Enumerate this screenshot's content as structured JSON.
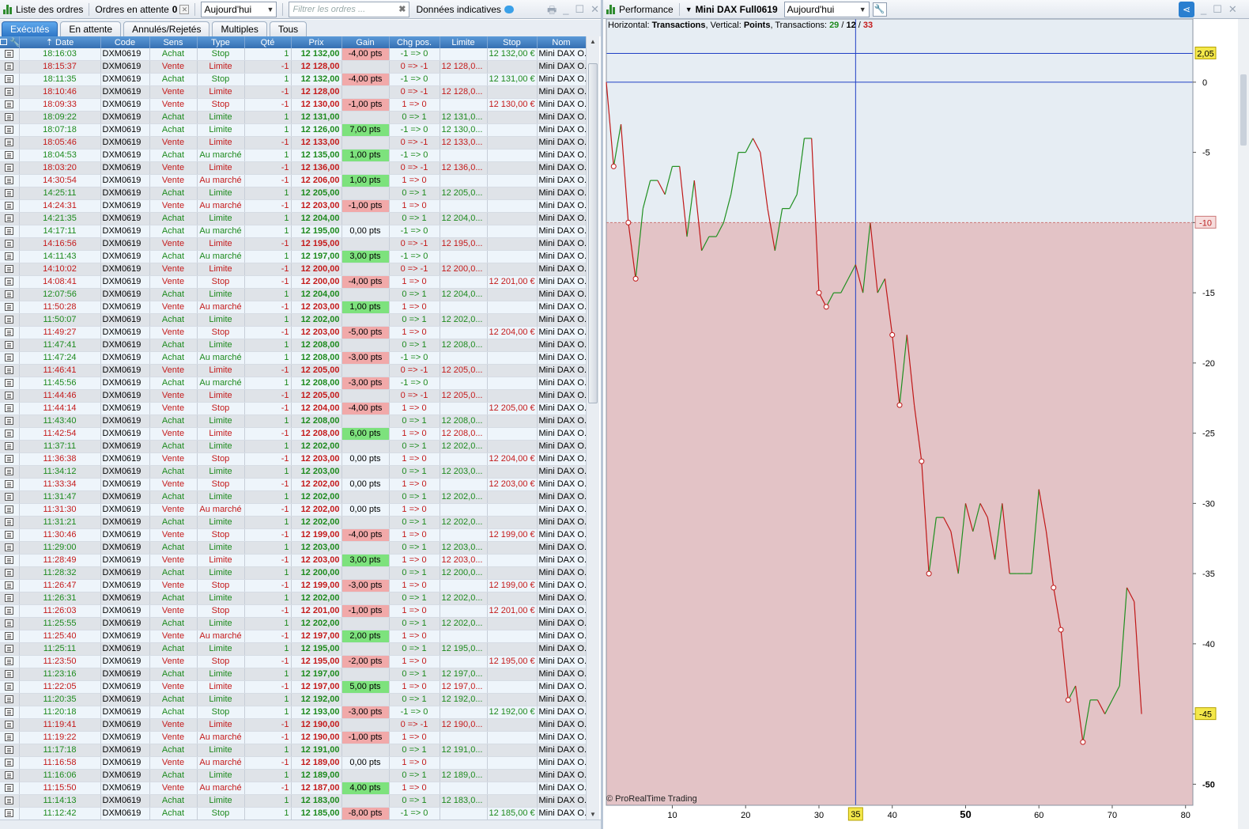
{
  "left_panel": {
    "title": "Liste des ordres",
    "pending_label": "Ordres en attente",
    "pending_count": "0",
    "period_select": "Aujourd'hui",
    "filter_placeholder": "Filtrer les ordres ...",
    "indicative_label": "Données indicatives",
    "tabs": [
      {
        "label": "Exécutés",
        "active": true
      },
      {
        "label": "En attente",
        "active": false
      },
      {
        "label": "Annulés/Rejetés",
        "active": false
      },
      {
        "label": "Multiples",
        "active": false
      },
      {
        "label": "Tous",
        "active": false
      }
    ],
    "columns": [
      "Date",
      "Code",
      "Sens",
      "Type",
      "Qté",
      "Prix",
      "Gain",
      "Chg pos.",
      "Limite",
      "Stop",
      "Nom"
    ],
    "rows": [
      [
        "18:16:03",
        "DXM0619",
        "Achat",
        "Stop",
        "1",
        "12 132,00",
        "-4,00 pts",
        "-1 => 0",
        "",
        "12 132,00 €",
        "Mini DAX O..."
      ],
      [
        "18:15:37",
        "DXM0619",
        "Vente",
        "Limite",
        "-1",
        "12 128,00",
        "",
        "0 => -1",
        "12 128,0...",
        "",
        "Mini DAX O..."
      ],
      [
        "18:11:35",
        "DXM0619",
        "Achat",
        "Stop",
        "1",
        "12 132,00",
        "-4,00 pts",
        "-1 => 0",
        "",
        "12 131,00 €",
        "Mini DAX O..."
      ],
      [
        "18:10:46",
        "DXM0619",
        "Vente",
        "Limite",
        "-1",
        "12 128,00",
        "",
        "0 => -1",
        "12 128,0...",
        "",
        "Mini DAX O..."
      ],
      [
        "18:09:33",
        "DXM0619",
        "Vente",
        "Stop",
        "-1",
        "12 130,00",
        "-1,00 pts",
        "1 => 0",
        "",
        "12 130,00 €",
        "Mini DAX O..."
      ],
      [
        "18:09:22",
        "DXM0619",
        "Achat",
        "Limite",
        "1",
        "12 131,00",
        "",
        "0 => 1",
        "12 131,0...",
        "",
        "Mini DAX O..."
      ],
      [
        "18:07:18",
        "DXM0619",
        "Achat",
        "Limite",
        "1",
        "12 126,00",
        "7,00 pts",
        "-1 => 0",
        "12 130,0...",
        "",
        "Mini DAX O..."
      ],
      [
        "18:05:46",
        "DXM0619",
        "Vente",
        "Limite",
        "-1",
        "12 133,00",
        "",
        "0 => -1",
        "12 133,0...",
        "",
        "Mini DAX O..."
      ],
      [
        "18:04:53",
        "DXM0619",
        "Achat",
        "Au marché",
        "1",
        "12 135,00",
        "1,00 pts",
        "-1 => 0",
        "",
        "",
        "Mini DAX O..."
      ],
      [
        "18:03:20",
        "DXM0619",
        "Vente",
        "Limite",
        "-1",
        "12 136,00",
        "",
        "0 => -1",
        "12 136,0...",
        "",
        "Mini DAX O..."
      ],
      [
        "14:30:54",
        "DXM0619",
        "Vente",
        "Au marché",
        "-1",
        "12 206,00",
        "1,00 pts",
        "1 => 0",
        "",
        "",
        "Mini DAX O..."
      ],
      [
        "14:25:11",
        "DXM0619",
        "Achat",
        "Limite",
        "1",
        "12 205,00",
        "",
        "0 => 1",
        "12 205,0...",
        "",
        "Mini DAX O..."
      ],
      [
        "14:24:31",
        "DXM0619",
        "Vente",
        "Au marché",
        "-1",
        "12 203,00",
        "-1,00 pts",
        "1 => 0",
        "",
        "",
        "Mini DAX O..."
      ],
      [
        "14:21:35",
        "DXM0619",
        "Achat",
        "Limite",
        "1",
        "12 204,00",
        "",
        "0 => 1",
        "12 204,0...",
        "",
        "Mini DAX O..."
      ],
      [
        "14:17:11",
        "DXM0619",
        "Achat",
        "Au marché",
        "1",
        "12 195,00",
        "0,00 pts",
        "-1 => 0",
        "",
        "",
        "Mini DAX O..."
      ],
      [
        "14:16:56",
        "DXM0619",
        "Vente",
        "Limite",
        "-1",
        "12 195,00",
        "",
        "0 => -1",
        "12 195,0...",
        "",
        "Mini DAX O..."
      ],
      [
        "14:11:43",
        "DXM0619",
        "Achat",
        "Au marché",
        "1",
        "12 197,00",
        "3,00 pts",
        "-1 => 0",
        "",
        "",
        "Mini DAX O..."
      ],
      [
        "14:10:02",
        "DXM0619",
        "Vente",
        "Limite",
        "-1",
        "12 200,00",
        "",
        "0 => -1",
        "12 200,0...",
        "",
        "Mini DAX O..."
      ],
      [
        "14:08:41",
        "DXM0619",
        "Vente",
        "Stop",
        "-1",
        "12 200,00",
        "-4,00 pts",
        "1 => 0",
        "",
        "12 201,00 €",
        "Mini DAX O..."
      ],
      [
        "12:07:56",
        "DXM0619",
        "Achat",
        "Limite",
        "1",
        "12 204,00",
        "",
        "0 => 1",
        "12 204,0...",
        "",
        "Mini DAX O..."
      ],
      [
        "11:50:28",
        "DXM0619",
        "Vente",
        "Au marché",
        "-1",
        "12 203,00",
        "1,00 pts",
        "1 => 0",
        "",
        "",
        "Mini DAX O..."
      ],
      [
        "11:50:07",
        "DXM0619",
        "Achat",
        "Limite",
        "1",
        "12 202,00",
        "",
        "0 => 1",
        "12 202,0...",
        "",
        "Mini DAX O..."
      ],
      [
        "11:49:27",
        "DXM0619",
        "Vente",
        "Stop",
        "-1",
        "12 203,00",
        "-5,00 pts",
        "1 => 0",
        "",
        "12 204,00 €",
        "Mini DAX O..."
      ],
      [
        "11:47:41",
        "DXM0619",
        "Achat",
        "Limite",
        "1",
        "12 208,00",
        "",
        "0 => 1",
        "12 208,0...",
        "",
        "Mini DAX O..."
      ],
      [
        "11:47:24",
        "DXM0619",
        "Achat",
        "Au marché",
        "1",
        "12 208,00",
        "-3,00 pts",
        "-1 => 0",
        "",
        "",
        "Mini DAX O..."
      ],
      [
        "11:46:41",
        "DXM0619",
        "Vente",
        "Limite",
        "-1",
        "12 205,00",
        "",
        "0 => -1",
        "12 205,0...",
        "",
        "Mini DAX O..."
      ],
      [
        "11:45:56",
        "DXM0619",
        "Achat",
        "Au marché",
        "1",
        "12 208,00",
        "-3,00 pts",
        "-1 => 0",
        "",
        "",
        "Mini DAX O..."
      ],
      [
        "11:44:46",
        "DXM0619",
        "Vente",
        "Limite",
        "-1",
        "12 205,00",
        "",
        "0 => -1",
        "12 205,0...",
        "",
        "Mini DAX O..."
      ],
      [
        "11:44:14",
        "DXM0619",
        "Vente",
        "Stop",
        "-1",
        "12 204,00",
        "-4,00 pts",
        "1 => 0",
        "",
        "12 205,00 €",
        "Mini DAX O..."
      ],
      [
        "11:43:40",
        "DXM0619",
        "Achat",
        "Limite",
        "1",
        "12 208,00",
        "",
        "0 => 1",
        "12 208,0...",
        "",
        "Mini DAX O..."
      ],
      [
        "11:42:54",
        "DXM0619",
        "Vente",
        "Limite",
        "-1",
        "12 208,00",
        "6,00 pts",
        "1 => 0",
        "12 208,0...",
        "",
        "Mini DAX O..."
      ],
      [
        "11:37:11",
        "DXM0619",
        "Achat",
        "Limite",
        "1",
        "12 202,00",
        "",
        "0 => 1",
        "12 202,0...",
        "",
        "Mini DAX O..."
      ],
      [
        "11:36:38",
        "DXM0619",
        "Vente",
        "Stop",
        "-1",
        "12 203,00",
        "0,00 pts",
        "1 => 0",
        "",
        "12 204,00 €",
        "Mini DAX O..."
      ],
      [
        "11:34:12",
        "DXM0619",
        "Achat",
        "Limite",
        "1",
        "12 203,00",
        "",
        "0 => 1",
        "12 203,0...",
        "",
        "Mini DAX O..."
      ],
      [
        "11:33:34",
        "DXM0619",
        "Vente",
        "Stop",
        "-1",
        "12 202,00",
        "0,00 pts",
        "1 => 0",
        "",
        "12 203,00 €",
        "Mini DAX O..."
      ],
      [
        "11:31:47",
        "DXM0619",
        "Achat",
        "Limite",
        "1",
        "12 202,00",
        "",
        "0 => 1",
        "12 202,0...",
        "",
        "Mini DAX O..."
      ],
      [
        "11:31:30",
        "DXM0619",
        "Vente",
        "Au marché",
        "-1",
        "12 202,00",
        "0,00 pts",
        "1 => 0",
        "",
        "",
        "Mini DAX O..."
      ],
      [
        "11:31:21",
        "DXM0619",
        "Achat",
        "Limite",
        "1",
        "12 202,00",
        "",
        "0 => 1",
        "12 202,0...",
        "",
        "Mini DAX O..."
      ],
      [
        "11:30:46",
        "DXM0619",
        "Vente",
        "Stop",
        "-1",
        "12 199,00",
        "-4,00 pts",
        "1 => 0",
        "",
        "12 199,00 €",
        "Mini DAX O..."
      ],
      [
        "11:29:00",
        "DXM0619",
        "Achat",
        "Limite",
        "1",
        "12 203,00",
        "",
        "0 => 1",
        "12 203,0...",
        "",
        "Mini DAX O..."
      ],
      [
        "11:28:49",
        "DXM0619",
        "Vente",
        "Limite",
        "-1",
        "12 203,00",
        "3,00 pts",
        "1 => 0",
        "12 203,0...",
        "",
        "Mini DAX O..."
      ],
      [
        "11:28:32",
        "DXM0619",
        "Achat",
        "Limite",
        "1",
        "12 200,00",
        "",
        "0 => 1",
        "12 200,0...",
        "",
        "Mini DAX O..."
      ],
      [
        "11:26:47",
        "DXM0619",
        "Vente",
        "Stop",
        "-1",
        "12 199,00",
        "-3,00 pts",
        "1 => 0",
        "",
        "12 199,00 €",
        "Mini DAX O..."
      ],
      [
        "11:26:31",
        "DXM0619",
        "Achat",
        "Limite",
        "1",
        "12 202,00",
        "",
        "0 => 1",
        "12 202,0...",
        "",
        "Mini DAX O..."
      ],
      [
        "11:26:03",
        "DXM0619",
        "Vente",
        "Stop",
        "-1",
        "12 201,00",
        "-1,00 pts",
        "1 => 0",
        "",
        "12 201,00 €",
        "Mini DAX O..."
      ],
      [
        "11:25:55",
        "DXM0619",
        "Achat",
        "Limite",
        "1",
        "12 202,00",
        "",
        "0 => 1",
        "12 202,0...",
        "",
        "Mini DAX O..."
      ],
      [
        "11:25:40",
        "DXM0619",
        "Vente",
        "Au marché",
        "-1",
        "12 197,00",
        "2,00 pts",
        "1 => 0",
        "",
        "",
        "Mini DAX O..."
      ],
      [
        "11:25:11",
        "DXM0619",
        "Achat",
        "Limite",
        "1",
        "12 195,00",
        "",
        "0 => 1",
        "12 195,0...",
        "",
        "Mini DAX O..."
      ],
      [
        "11:23:50",
        "DXM0619",
        "Vente",
        "Stop",
        "-1",
        "12 195,00",
        "-2,00 pts",
        "1 => 0",
        "",
        "12 195,00 €",
        "Mini DAX O..."
      ],
      [
        "11:23:16",
        "DXM0619",
        "Achat",
        "Limite",
        "1",
        "12 197,00",
        "",
        "0 => 1",
        "12 197,0...",
        "",
        "Mini DAX O..."
      ],
      [
        "11:22:05",
        "DXM0619",
        "Vente",
        "Limite",
        "-1",
        "12 197,00",
        "5,00 pts",
        "1 => 0",
        "12 197,0...",
        "",
        "Mini DAX O..."
      ],
      [
        "11:20:35",
        "DXM0619",
        "Achat",
        "Limite",
        "1",
        "12 192,00",
        "",
        "0 => 1",
        "12 192,0...",
        "",
        "Mini DAX O..."
      ],
      [
        "11:20:18",
        "DXM0619",
        "Achat",
        "Stop",
        "1",
        "12 193,00",
        "-3,00 pts",
        "-1 => 0",
        "",
        "12 192,00 €",
        "Mini DAX O..."
      ],
      [
        "11:19:41",
        "DXM0619",
        "Vente",
        "Limite",
        "-1",
        "12 190,00",
        "",
        "0 => -1",
        "12 190,0...",
        "",
        "Mini DAX O..."
      ],
      [
        "11:19:22",
        "DXM0619",
        "Vente",
        "Au marché",
        "-1",
        "12 190,00",
        "-1,00 pts",
        "1 => 0",
        "",
        "",
        "Mini DAX O..."
      ],
      [
        "11:17:18",
        "DXM0619",
        "Achat",
        "Limite",
        "1",
        "12 191,00",
        "",
        "0 => 1",
        "12 191,0...",
        "",
        "Mini DAX O..."
      ],
      [
        "11:16:58",
        "DXM0619",
        "Vente",
        "Au marché",
        "-1",
        "12 189,00",
        "0,00 pts",
        "1 => 0",
        "",
        "",
        "Mini DAX O..."
      ],
      [
        "11:16:06",
        "DXM0619",
        "Achat",
        "Limite",
        "1",
        "12 189,00",
        "",
        "0 => 1",
        "12 189,0...",
        "",
        "Mini DAX O..."
      ],
      [
        "11:15:50",
        "DXM0619",
        "Vente",
        "Au marché",
        "-1",
        "12 187,00",
        "4,00 pts",
        "1 => 0",
        "",
        "",
        "Mini DAX O..."
      ],
      [
        "11:14:13",
        "DXM0619",
        "Achat",
        "Limite",
        "1",
        "12 183,00",
        "",
        "0 => 1",
        "12 183,0...",
        "",
        "Mini DAX O..."
      ],
      [
        "11:12:42",
        "DXM0619",
        "Achat",
        "Stop",
        "1",
        "12 185,00",
        "-8,00 pts",
        "-1 => 0",
        "",
        "12 185,00 €",
        "Mini DAX O..."
      ]
    ]
  },
  "right_panel": {
    "title": "Performance",
    "instrument": "Mini DAX Full0619",
    "period_select": "Aujourd'hui",
    "info": {
      "h_label": "Horizontal:",
      "h_value": "Transactions",
      "v_label": "Vertical:",
      "v_value": "Points",
      "t_label": "Transactions:",
      "wins": "29",
      "losses": "12",
      "total": "33"
    },
    "copyright": "© ProRealTime Trading"
  },
  "chart_data": {
    "type": "line",
    "title": "",
    "xlabel": "Transactions",
    "ylabel": "Points",
    "xlim": [
      1,
      81
    ],
    "ylim": [
      -51.5,
      4.5
    ],
    "x_ticks": [
      10,
      20,
      30,
      40,
      50,
      60,
      70,
      80
    ],
    "y_ticks": [
      0,
      -5,
      -10,
      -15,
      -20,
      -25,
      -30,
      -35,
      -40,
      -45,
      -50
    ],
    "reference_lines": [
      2.05,
      0
    ],
    "drawdown_level": -10,
    "crosshair_x": 35,
    "value_badges": [
      "2,05",
      "-10",
      "-45"
    ],
    "colors": {
      "up": "#1f8f1f",
      "down": "#c01818",
      "profit_zone": "#e6edf3",
      "loss_zone": "#e3c3c6",
      "axis_lines": "#1f3fc4"
    },
    "x": [
      1,
      2,
      3,
      4,
      5,
      6,
      7,
      8,
      9,
      10,
      11,
      12,
      13,
      14,
      15,
      16,
      17,
      18,
      19,
      20,
      21,
      22,
      23,
      24,
      25,
      26,
      27,
      28,
      29,
      30,
      31,
      32,
      33,
      34,
      35,
      36,
      37,
      38,
      39,
      40,
      41,
      42,
      43,
      44,
      45,
      46,
      47,
      48,
      49,
      50,
      51,
      52,
      53,
      54,
      55,
      56,
      57,
      58,
      59,
      60,
      61,
      62,
      63,
      64,
      65,
      66,
      67,
      68,
      69,
      70,
      71,
      72,
      73,
      74
    ],
    "values": [
      0,
      -6,
      -3,
      -10,
      -14,
      -9,
      -7,
      -7,
      -8,
      -6,
      -6,
      -11,
      -7,
      -12,
      -11,
      -11,
      -10,
      -8,
      -5,
      -5,
      -4,
      -5,
      -9,
      -12,
      -9,
      -9,
      -8,
      -4,
      -4,
      -15,
      -16,
      -15,
      -15,
      -14,
      -13,
      -15,
      -10,
      -15,
      -14,
      -18,
      -23,
      -18,
      -23,
      -27,
      -35,
      -31,
      -31,
      -32,
      -35,
      -30,
      -32,
      -30,
      -31,
      -34,
      -30,
      -35,
      -35,
      -35,
      -35,
      -29,
      -32,
      -36,
      -39,
      -44,
      -43,
      -47,
      -44,
      -44,
      -45,
      -44,
      -43,
      -36,
      -37,
      -45
    ],
    "markers_at": [
      2,
      4,
      5,
      30,
      31,
      40,
      41,
      44,
      45,
      62,
      63,
      64,
      66
    ]
  }
}
